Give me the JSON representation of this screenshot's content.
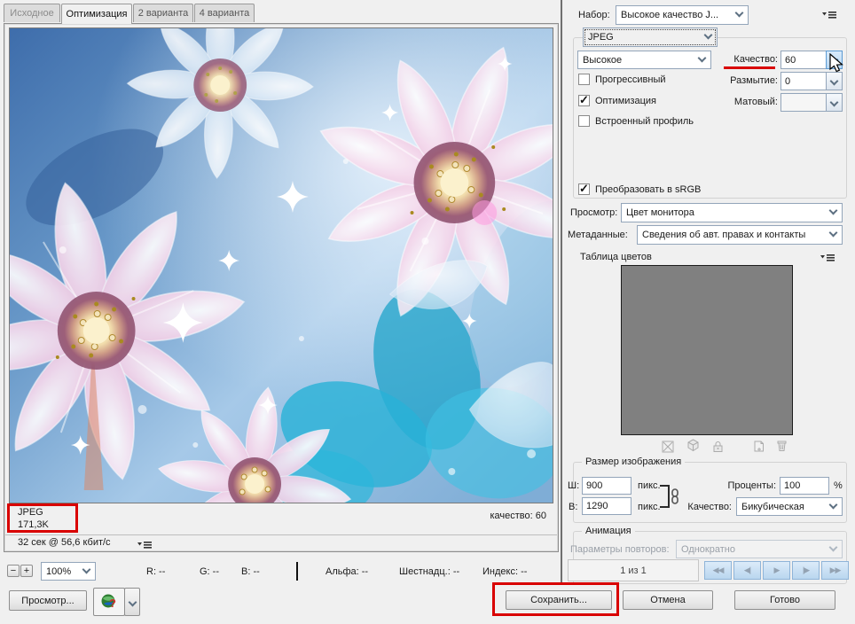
{
  "tabs": {
    "items": [
      {
        "label": "Исходное"
      },
      {
        "label": "Оптимизация"
      },
      {
        "label": "2 варианта"
      },
      {
        "label": "4 варианта"
      }
    ]
  },
  "optimize_panel": {
    "preset_label": "Набор:",
    "preset_value": "Высокое качество J...",
    "format_value": "JPEG",
    "compression_value": "Высокое",
    "quality_label": "Качество:",
    "quality_value": "60",
    "progressive_label": "Прогрессивный",
    "blur_label": "Размытие:",
    "blur_value": "0",
    "optimized_label": "Оптимизация",
    "matte_label": "Матовый:",
    "matte_value": "",
    "embedded_profile_label": "Встроенный профиль",
    "srgb_label": "Преобразовать в sRGB",
    "preview_label": "Просмотр:",
    "preview_value": "Цвет монитора",
    "metadata_label": "Метаданные:",
    "metadata_value": "Сведения об авт. правах и контакты"
  },
  "color_table": {
    "title": "Таблица цветов"
  },
  "image_size": {
    "title": "Размер изображения",
    "width_label": "Ш:",
    "width_value": "900",
    "px_label": "пикс.",
    "height_label": "В:",
    "height_value": "1290",
    "percent_label": "Проценты:",
    "percent_value": "100",
    "percent_unit": "%",
    "quality_label": "Качество:",
    "quality_value": "Бикубическая"
  },
  "animation": {
    "title": "Анимация",
    "loop_label": "Параметры повторов:",
    "loop_value": "Однократно",
    "frame_counter": "1 из 1",
    "player_icons": [
      "◀◀",
      "◀|",
      "▶",
      "|▶",
      "▶▶"
    ]
  },
  "preview_info": {
    "format": "JPEG",
    "size": "171,3K",
    "time": "32 сек @ 56,6 кбит/с",
    "quality": "качество: 60"
  },
  "status_bar": {
    "zoom_out": "−",
    "zoom_in": "+",
    "zoom_value": "100%",
    "r": "R: --",
    "g": "G: --",
    "b": "B: --",
    "alpha": "Альфа: --",
    "hex": "Шестнадц.: --",
    "index": "Индекс: --"
  },
  "footer": {
    "preview_button": "Просмотр...",
    "save_button": "Сохранить...",
    "cancel_button": "Отмена",
    "done_button": "Готово"
  },
  "colors": {
    "annotation_red": "#d90000",
    "panel_bg": "#f0f0f0"
  }
}
